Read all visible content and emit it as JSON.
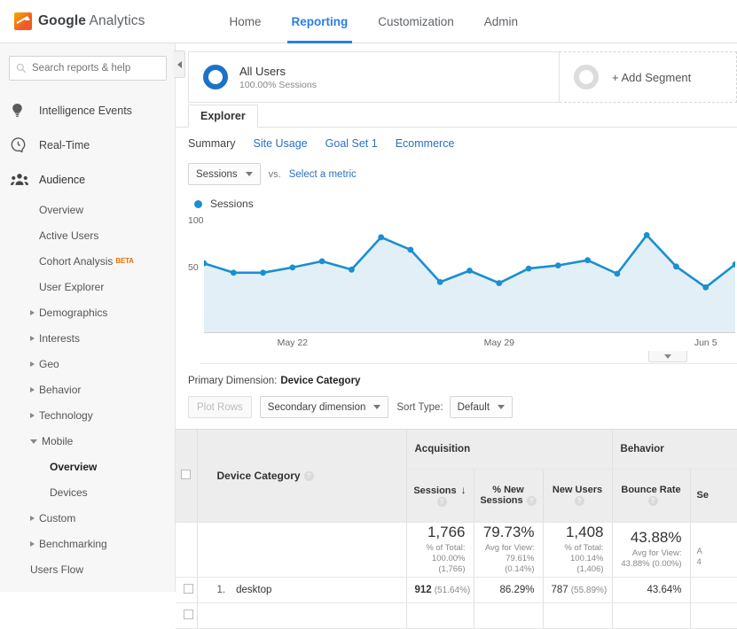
{
  "topbar": {
    "brand_bold": "Google",
    "brand_rest": " Analytics",
    "nav": [
      {
        "label": "Home",
        "active": false
      },
      {
        "label": "Reporting",
        "active": true
      },
      {
        "label": "Customization",
        "active": false
      },
      {
        "label": "Admin",
        "active": false
      }
    ],
    "accent": "#2b7de9"
  },
  "sidebar": {
    "search_placeholder": "Search reports & help",
    "top_items": [
      {
        "label": "Intelligence Events",
        "icon": "lightbulb-icon"
      },
      {
        "label": "Real-Time",
        "icon": "clock-icon"
      },
      {
        "label": "Audience",
        "icon": "people-icon"
      }
    ],
    "audience_items": [
      {
        "label": "Overview"
      },
      {
        "label": "Active Users"
      },
      {
        "label": "Cohort Analysis",
        "badge": "BETA"
      },
      {
        "label": "User Explorer"
      }
    ],
    "expandable": [
      {
        "label": "Demographics",
        "open": false
      },
      {
        "label": "Interests",
        "open": false
      },
      {
        "label": "Geo",
        "open": false
      },
      {
        "label": "Behavior",
        "open": false
      },
      {
        "label": "Technology",
        "open": false
      },
      {
        "label": "Mobile",
        "open": true
      }
    ],
    "mobile_children": [
      {
        "label": "Overview",
        "current": true
      },
      {
        "label": "Devices",
        "current": false
      }
    ],
    "tail": [
      {
        "label": "Custom",
        "open": false
      },
      {
        "label": "Benchmarking",
        "open": false
      }
    ],
    "users_flow": "Users Flow"
  },
  "segments": {
    "all_users_title": "All Users",
    "all_users_sub": "100.00% Sessions",
    "add_segment": "+ Add Segment",
    "segment_color": "#1a73c7"
  },
  "tabs": {
    "explorer": "Explorer",
    "subtabs": [
      {
        "label": "Summary",
        "active": true
      },
      {
        "label": "Site Usage",
        "active": false
      },
      {
        "label": "Goal Set 1",
        "active": false
      },
      {
        "label": "Ecommerce",
        "active": false
      }
    ]
  },
  "metric_controls": {
    "metric": "Sessions",
    "vs": "vs.",
    "select_metric": "Select a metric",
    "legend": "Sessions"
  },
  "chart_data": {
    "type": "line",
    "title": "Sessions",
    "series": [
      {
        "name": "Sessions",
        "color": "#1a8fd1",
        "values": [
          66,
          57,
          57,
          62,
          68,
          60,
          91,
          79,
          48,
          59,
          47,
          61,
          64,
          69,
          56,
          93,
          63,
          43,
          65
        ]
      }
    ],
    "x": [
      "May 19",
      "May 20",
      "May 21",
      "May 22",
      "May 23",
      "May 24",
      "May 25",
      "May 26",
      "May 27",
      "May 28",
      "May 29",
      "May 30",
      "May 31",
      "Jun 1",
      "Jun 2",
      "Jun 3",
      "Jun 4",
      "Jun 5",
      "Jun 6"
    ],
    "xtick_labels": [
      "May 22",
      "May 29",
      "Jun 5"
    ],
    "xtick_indices": [
      3,
      10,
      17
    ],
    "ytick_labels": [
      "100",
      "50"
    ],
    "ylim": [
      0,
      112
    ],
    "grid": false,
    "legend_position": "top-left",
    "fill_color": "#e3eff7",
    "ylabel": "",
    "xlabel": ""
  },
  "primary_dimension": {
    "label": "Primary Dimension:",
    "value": "Device Category"
  },
  "table_controls": {
    "plot_rows": "Plot Rows",
    "secondary_dimension": "Secondary dimension",
    "sort_type_label": "Sort Type:",
    "sort_type_value": "Default"
  },
  "table": {
    "group_headers": [
      {
        "label": "Acquisition",
        "span": 3
      },
      {
        "label": "Behavior",
        "span": 2
      }
    ],
    "dimension_header": "Device Category",
    "columns": [
      {
        "label": "Sessions",
        "sorted": true,
        "sort_arrow": "↓"
      },
      {
        "label": "% New Sessions",
        "sorted": false
      },
      {
        "label": "New Users",
        "sorted": false
      },
      {
        "label": "Bounce Rate",
        "sorted": false
      },
      {
        "label": "Se",
        "sorted": false
      }
    ],
    "totals": [
      {
        "big": "1,766",
        "l1": "% of Total:",
        "l2": "100.00%",
        "l3": "(1,766)"
      },
      {
        "big": "79.73%",
        "l1": "Avg for View:",
        "l2": "79.61% (0.14%)",
        "l3": ""
      },
      {
        "big": "1,408",
        "l1": "% of Total:",
        "l2": "100.14%",
        "l3": "(1,406)"
      },
      {
        "big": "43.88%",
        "l1": "Avg for View:",
        "l2": "43.88% (0.00%)",
        "l3": ""
      },
      {
        "big": "",
        "l1": "A",
        "l2": "4",
        "l3": ""
      }
    ],
    "rows": [
      {
        "index": "1.",
        "name": "desktop",
        "sessions": "912",
        "sessions_pct": "(51.64%)",
        "new_sessions": "86.29%",
        "new_users": "787",
        "new_users_pct": "(55.89%)",
        "bounce_rate": "43.64%",
        "last": ""
      }
    ]
  }
}
